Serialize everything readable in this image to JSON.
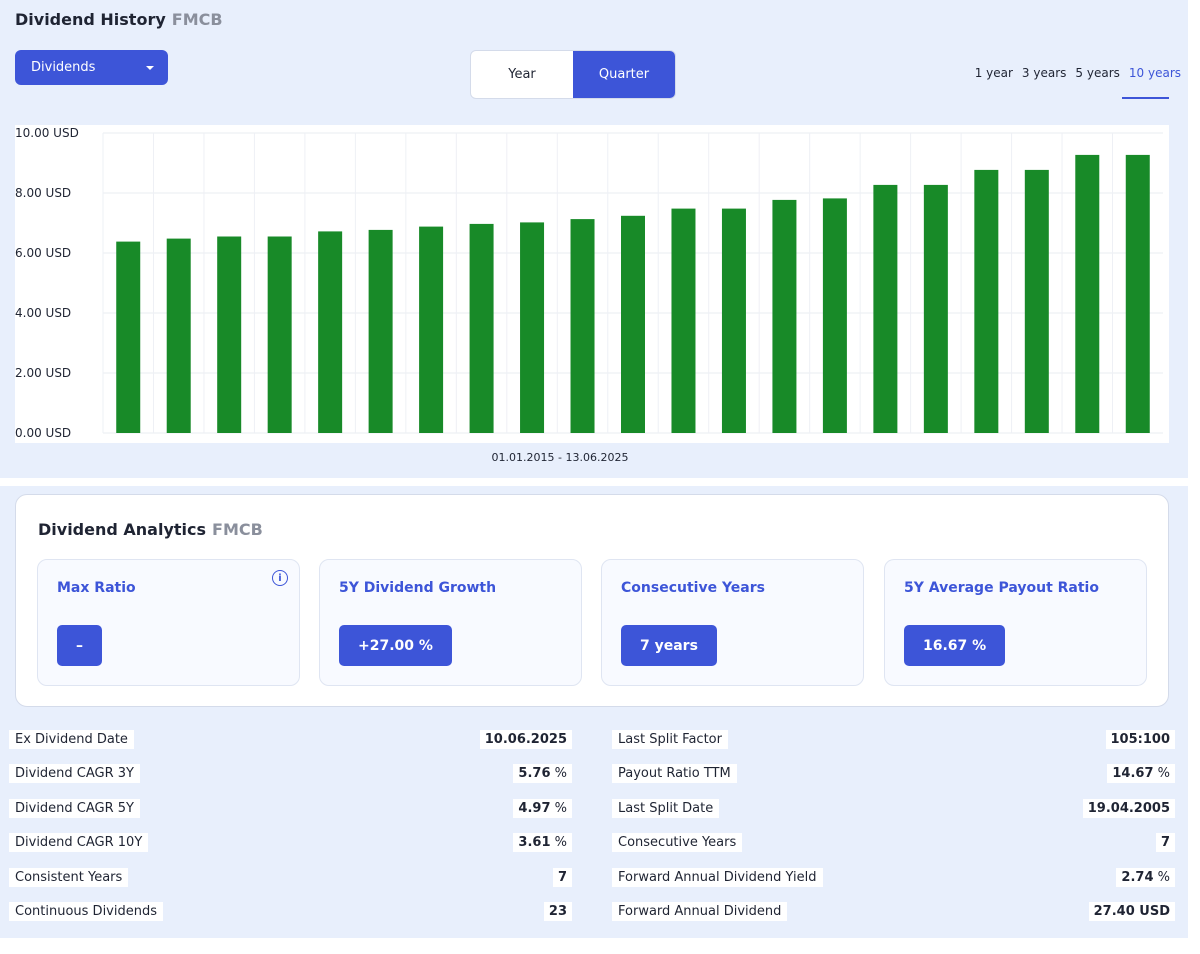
{
  "header": {
    "title": "Dividend History",
    "ticker": "FMCB"
  },
  "dropdown": {
    "label": "Dividends"
  },
  "period_toggle": {
    "year": "Year",
    "quarter": "Quarter",
    "selected": "Quarter"
  },
  "ranges": [
    "1 year",
    "3 years",
    "5 years",
    "10 years"
  ],
  "selected_range": "10 years",
  "colors": {
    "accent": "#3d55d8",
    "bar": "#188a28",
    "panel": "#e8effc"
  },
  "chart_data": {
    "type": "bar",
    "x_range_label": "01.01.2015 - 13.06.2025",
    "y_ticks": [
      "0.00 USD",
      "2.00 USD",
      "4.00 USD",
      "6.00 USD",
      "8.00 USD",
      "10.00 USD"
    ],
    "ylim": [
      0,
      10
    ],
    "grid": true,
    "values": [
      6.38,
      6.48,
      6.55,
      6.55,
      6.72,
      6.77,
      6.88,
      6.97,
      7.02,
      7.13,
      7.24,
      7.48,
      7.48,
      7.77,
      7.82,
      8.27,
      8.27,
      8.77,
      8.77,
      9.27,
      9.27
    ]
  },
  "analytics": {
    "title": "Dividend Analytics",
    "ticker": "FMCB",
    "cards": [
      {
        "label": "Max Ratio",
        "value": "–"
      },
      {
        "label": "5Y Dividend Growth",
        "value": "+27.00 %"
      },
      {
        "label": "Consecutive Years",
        "value": "7 years"
      },
      {
        "label": "5Y Average Payout Ratio",
        "value": "16.67 %"
      }
    ]
  },
  "stats": {
    "left": [
      {
        "label": "Ex Dividend Date",
        "value": "10.06.2025",
        "unit": ""
      },
      {
        "label": "Dividend CAGR 3Y",
        "value": "5.76",
        "unit": " %"
      },
      {
        "label": "Dividend CAGR 5Y",
        "value": "4.97",
        "unit": " %"
      },
      {
        "label": "Dividend CAGR 10Y",
        "value": "3.61",
        "unit": " %"
      },
      {
        "label": "Consistent Years",
        "value": "7",
        "unit": ""
      },
      {
        "label": "Continuous Dividends",
        "value": "23",
        "unit": ""
      }
    ],
    "right": [
      {
        "label": "Last Split Factor",
        "value": "105:100",
        "unit": ""
      },
      {
        "label": "Payout Ratio TTM",
        "value": "14.67",
        "unit": " %"
      },
      {
        "label": "Last Split Date",
        "value": "19.04.2005",
        "unit": ""
      },
      {
        "label": "Consecutive Years",
        "value": "7",
        "unit": ""
      },
      {
        "label": "Forward Annual Dividend Yield",
        "value": "2.74",
        "unit": " %"
      },
      {
        "label": "Forward Annual Dividend",
        "value": "27.40 USD",
        "unit": ""
      }
    ]
  }
}
